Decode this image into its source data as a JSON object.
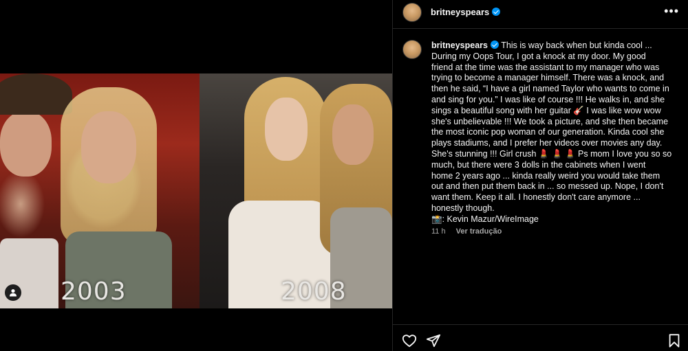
{
  "media": {
    "photos": [
      {
        "year_label": "2003"
      },
      {
        "year_label": "2008"
      }
    ]
  },
  "post": {
    "username": "britneyspears",
    "verified": true,
    "caption_lines": [
      "This is way back when but kinda cool ...",
      "During my Oops Tour, I got a knock at my door. My good",
      "friend at the time was the assistant to my manager who was",
      "trying to become a manager himself. There was a knock, and",
      "then he said, “I have a girl named Taylor who wants to come in",
      "and sing for you.” I was like of course !!! He walks in, and she",
      "sings a beautiful song with her guitar 🎸 I was like wow wow",
      "she's unbelievable !!! We took a picture, and she then became",
      "the most iconic pop woman of our generation. Kinda cool she",
      "plays stadiums, and I prefer her videos over movies any day.",
      "She's stunning !!! Girl crush 💄 💄 💄 Ps mom I love you so so",
      "much, but there were 3 dolls in the cabinets when I went",
      "home 2 years ago ... kinda really weird you would take them",
      "out and then put them back in ... so messed up. Nope, I don't",
      "want them. Keep it all. I honestly don't care anymore ...",
      "honestly though.",
      "📸: Kevin Mazur/WireImage"
    ],
    "time_ago": "11 h",
    "see_translation": "Ver tradução"
  },
  "icons": {
    "more": "more-options-icon",
    "like": "heart-icon",
    "share": "paper-plane-icon",
    "save": "bookmark-icon",
    "tag_user": "user-tag-icon"
  },
  "colors": {
    "background": "#000000",
    "text": "#f5f5f5",
    "muted": "#a8a8a8",
    "verified": "#0095f6",
    "divider": "#262626"
  }
}
